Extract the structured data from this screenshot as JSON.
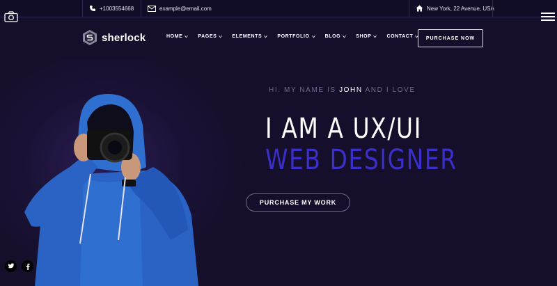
{
  "topbar": {
    "phone": "+1003554668",
    "email": "example@email.com",
    "address": "New York, 22 Avenue, USA"
  },
  "header": {
    "logo_text": "sherlock",
    "nav": [
      {
        "label": "HOME"
      },
      {
        "label": "PAGES"
      },
      {
        "label": "ELEMENTS"
      },
      {
        "label": "PORTFOLIO"
      },
      {
        "label": "BLOG"
      },
      {
        "label": "SHOP"
      },
      {
        "label": "CONTACT"
      }
    ],
    "cta_label": "PURCHASE NOW"
  },
  "hero": {
    "intro_prefix": "HI. MY NAME IS",
    "intro_name": "JOHN",
    "intro_suffix": "AND I LOVE",
    "headline_line1": "I AM A UX/UI",
    "headline_line2": "WEB DESIGNER",
    "button_label": "PURCHASE MY WORK"
  },
  "icons": {
    "camera": "camera-icon",
    "menu": "hamburger-menu-icon",
    "phone": "phone-icon",
    "email": "envelope-icon",
    "address": "home-icon",
    "twitter": "twitter-icon",
    "facebook": "facebook-icon"
  },
  "colors": {
    "background": "#150f2b",
    "accent": "#3b2fc9",
    "muted_text": "#6e6a8c"
  }
}
